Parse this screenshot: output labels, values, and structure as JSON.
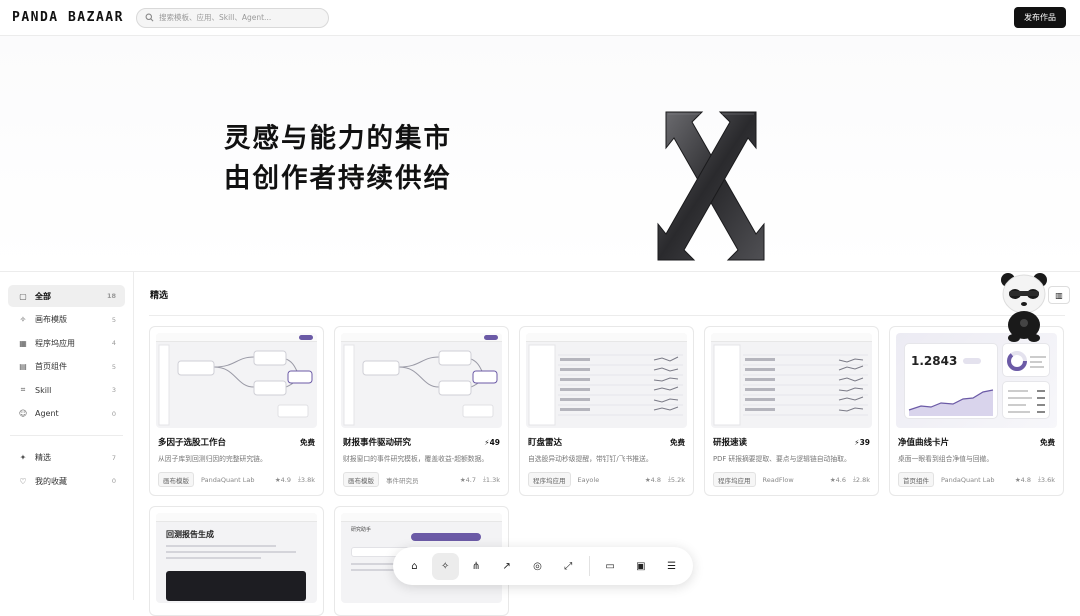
{
  "brand": {
    "logo": "PANDA BAZAAR"
  },
  "search": {
    "placeholder": "搜索模板、应用、Skill、Agent..."
  },
  "header": {
    "publish_label": "发布作品"
  },
  "hero": {
    "title_line1": "灵感与能力的集市",
    "title_line2": "由创作者持续供给"
  },
  "sidebar": {
    "items": [
      {
        "icon": "box-icon",
        "glyph": "▢",
        "label": "全部",
        "count": "18",
        "active": true
      },
      {
        "icon": "sparkle-icon",
        "glyph": "✧",
        "label": "画布模版",
        "count": "5"
      },
      {
        "icon": "grid-icon",
        "glyph": "▦",
        "label": "程序坞应用",
        "count": "4"
      },
      {
        "icon": "layout-icon",
        "glyph": "▤",
        "label": "首页组件",
        "count": "5"
      },
      {
        "icon": "terminal-icon",
        "glyph": "⌗",
        "label": "Skill",
        "count": "3"
      },
      {
        "icon": "bot-icon",
        "glyph": "☺",
        "label": "Agent",
        "count": "0"
      }
    ],
    "secondary": [
      {
        "icon": "sparkle-icon",
        "glyph": "✦",
        "label": "精选",
        "count": "7"
      },
      {
        "icon": "heart-icon",
        "glyph": "♡",
        "label": "我的收藏",
        "count": "0"
      }
    ]
  },
  "section": {
    "title": "精选"
  },
  "cards": [
    {
      "title": "多因子选股工作台",
      "price": "免费",
      "desc": "从因子库到回测归因的完整研究链。",
      "tag": "画布模版",
      "author": "PandaQuant Lab",
      "rating": "4.9",
      "downloads": "3.8k",
      "thumb": "flow"
    },
    {
      "title": "财报事件驱动研究",
      "price": "⚡49",
      "desc": "财报窗口的事件研究模板，覆盖收益-超额数据。",
      "tag": "画布模版",
      "author": "事件研究员",
      "rating": "4.7",
      "downloads": "1.3k",
      "thumb": "flow"
    },
    {
      "title": "盯盘雷达",
      "price": "免费",
      "desc": "自选股异动秒级提醒，带钉钉/飞书推送。",
      "tag": "程序坞应用",
      "author": "Eayole",
      "rating": "4.8",
      "downloads": "5.2k",
      "thumb": "table"
    },
    {
      "title": "研报速读",
      "price": "⚡39",
      "desc": "PDF 研报摘要提取、要点与逻辑链自动抽取。",
      "tag": "程序坞应用",
      "author": "ReadFlow",
      "rating": "4.6",
      "downloads": "2.8k",
      "thumb": "table"
    },
    {
      "title": "净值曲线卡片",
      "price": "免费",
      "desc": "桌面一眼看到组合净值与回撤。",
      "tag": "首页组件",
      "author": "PandaQuant Lab",
      "rating": "4.8",
      "downloads": "3.6k",
      "thumb": "nav",
      "nav_value": "1.2843"
    }
  ],
  "partial_cards": [
    {
      "thumb_title": "回测报告生成"
    },
    {
      "thumb_title": "研究助手"
    }
  ],
  "dock": [
    {
      "icon": "home-icon",
      "glyph": "⌂"
    },
    {
      "icon": "sparkle-pointer-icon",
      "glyph": "✧",
      "active": true
    },
    {
      "icon": "graph-icon",
      "glyph": "⋔"
    },
    {
      "icon": "trend-icon",
      "glyph": "↗"
    },
    {
      "icon": "compass-icon",
      "glyph": "◎"
    },
    {
      "icon": "expand-icon",
      "glyph": "⤢"
    },
    {
      "icon": "folder-icon",
      "glyph": "▭"
    },
    {
      "icon": "terminal-icon",
      "glyph": "▣"
    },
    {
      "icon": "sliders-icon",
      "glyph": "☰"
    }
  ],
  "colors": {
    "accent": "#6b5aa6",
    "dark": "#111111"
  }
}
